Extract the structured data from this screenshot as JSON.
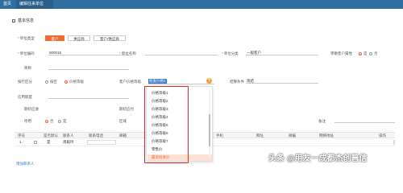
{
  "tabs": [
    {
      "label": "首页"
    },
    {
      "label": "编辑往来单位"
    }
  ],
  "section": {
    "title": "基本信息"
  },
  "row1": {
    "label": "单位类型",
    "buttons": [
      "客户",
      "供应商",
      "客户/供应商"
    ]
  },
  "row2": {
    "code_label": "单位编码",
    "code_value": "000016",
    "name_label": "单位名称",
    "name_value": "",
    "class_label": "单位分类",
    "class_value": "一般客户",
    "retail_label": "零散客户属性",
    "yes": "是",
    "no": "否"
  },
  "row3": {
    "alias_label": "简称"
  },
  "row4": {
    "area_label": "按行区分",
    "opt_a": "按区",
    "opt_b": "价格等级",
    "price_label": "客户价格等级",
    "price_value": "批发价格2",
    "settle_label": "结算条件",
    "settle_value": "现结"
  },
  "row5": {
    "credit_label": "信用额度"
  },
  "row6": {
    "invoice_label": "期初应收",
    "period_label": "期初应付"
  },
  "row7": {
    "disable_label": "停用",
    "no": "否",
    "yes": "是",
    "region_label": "区域",
    "remark_label": "备注"
  },
  "dropdown": {
    "options": [
      "价格等级1",
      "价格等级2",
      "价格等级3",
      "价格等级4",
      "价格等级5",
      "价格等级6",
      "价格等级7",
      "零售价",
      "最高批发价"
    ],
    "selected_index": 8
  },
  "table": {
    "headers": [
      "序号",
      "",
      "是否默认",
      "联系人",
      "联系电话",
      "邮箱",
      "手机",
      "网址",
      "邮编",
      "网络地址",
      "操作"
    ],
    "rows": [
      {
        "index": "1",
        "default": "是",
        "contact": "周聪玲",
        "phone": "",
        "op": ""
      }
    ],
    "add_label": "增加联系人"
  },
  "watermark": "头条 @用友一成都杰创普信"
}
